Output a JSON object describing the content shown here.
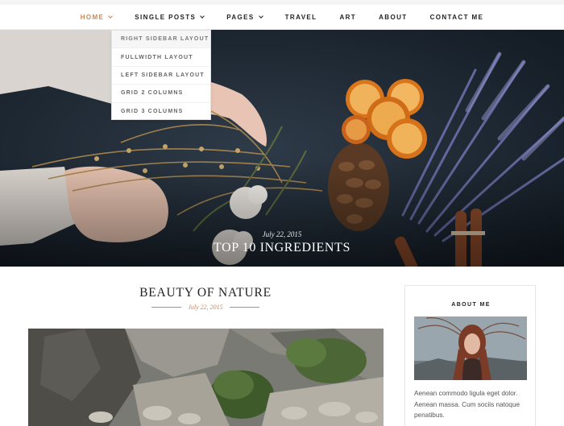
{
  "nav": {
    "items": [
      {
        "label": "HOME",
        "has_dropdown": true,
        "active": true
      },
      {
        "label": "SINGLE POSTS",
        "has_dropdown": true,
        "active": false
      },
      {
        "label": "PAGES",
        "has_dropdown": true,
        "active": false
      },
      {
        "label": "TRAVEL",
        "has_dropdown": false,
        "active": false
      },
      {
        "label": "ART",
        "has_dropdown": false,
        "active": false
      },
      {
        "label": "ABOUT",
        "has_dropdown": false,
        "active": false
      },
      {
        "label": "CONTACT ME",
        "has_dropdown": false,
        "active": false
      }
    ],
    "dropdown": [
      "RIGHT SIDEBAR LAYOUT",
      "FULLWIDTH LAYOUT",
      "LEFT SIDEBAR LAYOUT",
      "GRID 2 COLUMNS",
      "GRID 3 COLUMNS"
    ]
  },
  "hero": {
    "date": "July 22, 2015",
    "title": "TOP 10 INGREDIENTS"
  },
  "post": {
    "title": "BEAUTY OF NATURE",
    "date": "July 22, 2015"
  },
  "sidebar": {
    "about": {
      "title": "ABOUT ME",
      "text": "Aenean commodo ligula eget dolor. Aenean massa. Cum sociis natoque penatibus."
    }
  },
  "colors": {
    "accent": "#c9875a",
    "text": "#222222"
  }
}
